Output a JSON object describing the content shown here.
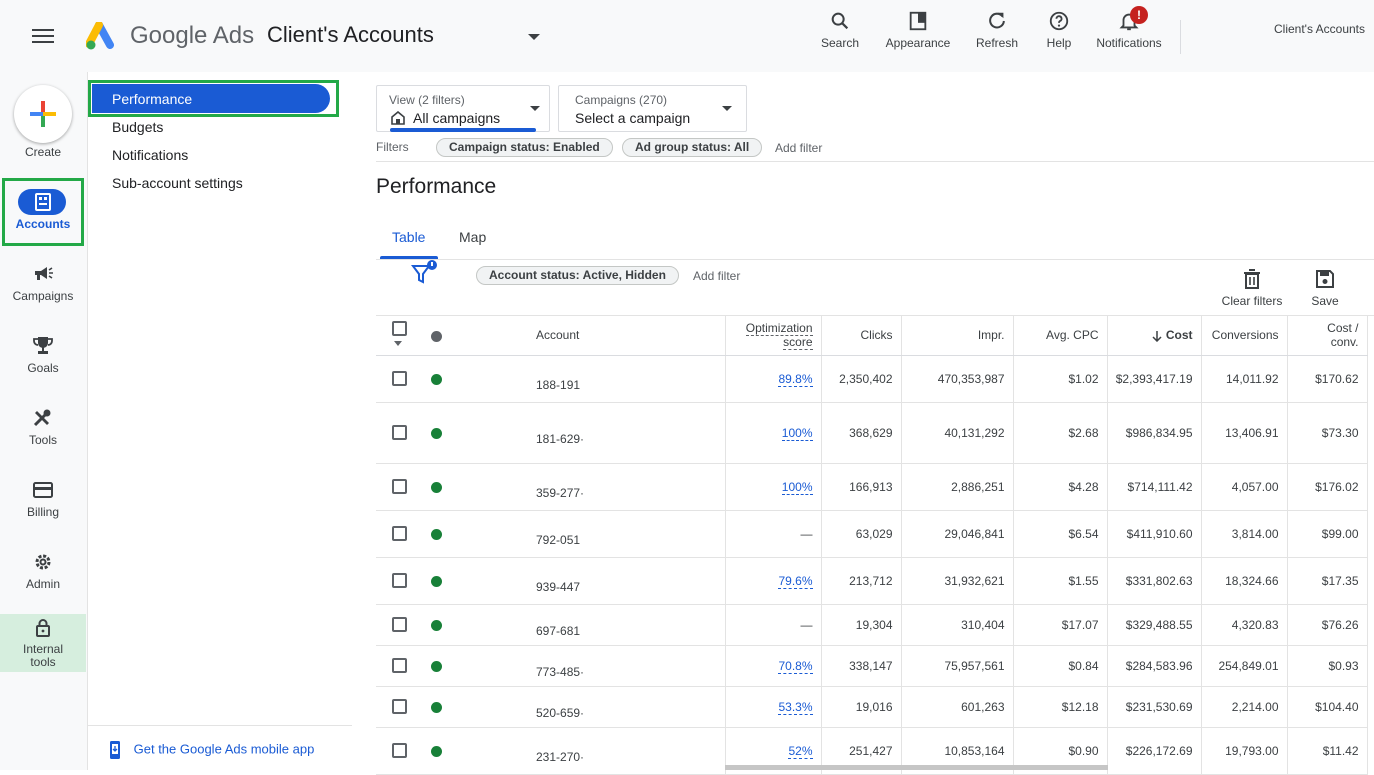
{
  "header": {
    "brand": "Google Ads",
    "account_title": "Client's Accounts",
    "tools": [
      {
        "label": "Search",
        "icon": "search-icon"
      },
      {
        "label": "Appearance",
        "icon": "appearance-icon"
      },
      {
        "label": "Refresh",
        "icon": "refresh-icon"
      },
      {
        "label": "Help",
        "icon": "help-icon"
      },
      {
        "label": "Notifications",
        "icon": "bell-icon"
      }
    ],
    "notification_badge": "!",
    "right_account": "Client's Accounts"
  },
  "rail": {
    "create": "Create",
    "items": [
      {
        "label": "Accounts",
        "icon": "accounts-icon"
      },
      {
        "label": "Campaigns",
        "icon": "megaphone-icon"
      },
      {
        "label": "Goals",
        "icon": "trophy-icon"
      },
      {
        "label": "Tools",
        "icon": "tools-icon"
      },
      {
        "label": "Billing",
        "icon": "card-icon"
      },
      {
        "label": "Admin",
        "icon": "gear-icon"
      },
      {
        "label": "Internal tools",
        "icon": "lock-icon"
      }
    ]
  },
  "subnav": {
    "items": [
      "Performance",
      "Budgets",
      "Notifications",
      "Sub-account settings"
    ],
    "mobile_link": "Get the Google Ads mobile app"
  },
  "filters": {
    "view_small": "View (2 filters)",
    "view_value": "All campaigns",
    "campaigns_small": "Campaigns (270)",
    "campaigns_value": "Select a campaign",
    "label": "Filters",
    "chips": [
      "Campaign status: Enabled",
      "Ad group status: All"
    ],
    "add_filter": "Add filter"
  },
  "main": {
    "title": "Performance",
    "tabs": [
      "Table",
      "Map"
    ],
    "table_chip": "Account status: Active, Hidden",
    "table_add_filter": "Add filter",
    "clear_filters": "Clear filters",
    "save": "Save"
  },
  "table": {
    "columns": {
      "account": "Account",
      "opt_line1": "Optimization",
      "opt_line2": "score",
      "clicks": "Clicks",
      "impr": "Impr.",
      "avg_cpc": "Avg. CPC",
      "cost": "Cost",
      "conversions": "Conversions",
      "cost_conv_line1": "Cost /",
      "cost_conv_line2": "conv."
    },
    "rows": [
      {
        "account": "188-191",
        "opt": "89.8%",
        "clicks": "2,350,402",
        "impr": "470,353,987",
        "cpc": "$1.02",
        "cost": "$2,393,417.19",
        "conv": "14,011.92",
        "cost_conv": "$170.62"
      },
      {
        "account": "181-629·",
        "opt": "100%",
        "clicks": "368,629",
        "impr": "40,131,292",
        "cpc": "$2.68",
        "cost": "$986,834.95",
        "conv": "13,406.91",
        "cost_conv": "$73.30"
      },
      {
        "account": "359-277·",
        "opt": "100%",
        "clicks": "166,913",
        "impr": "2,886,251",
        "cpc": "$4.28",
        "cost": "$714,111.42",
        "conv": "4,057.00",
        "cost_conv": "$176.02"
      },
      {
        "account": "792-051",
        "opt": "—",
        "clicks": "63,029",
        "impr": "29,046,841",
        "cpc": "$6.54",
        "cost": "$411,910.60",
        "conv": "3,814.00",
        "cost_conv": "$99.00"
      },
      {
        "account": "939-447",
        "opt": "79.6%",
        "clicks": "213,712",
        "impr": "31,932,621",
        "cpc": "$1.55",
        "cost": "$331,802.63",
        "conv": "18,324.66",
        "cost_conv": "$17.35"
      },
      {
        "account": "697-681",
        "opt": "—",
        "clicks": "19,304",
        "impr": "310,404",
        "cpc": "$17.07",
        "cost": "$329,488.55",
        "conv": "4,320.83",
        "cost_conv": "$76.26"
      },
      {
        "account": "773-485·",
        "opt": "70.8%",
        "clicks": "338,147",
        "impr": "75,957,561",
        "cpc": "$0.84",
        "cost": "$284,583.96",
        "conv": "254,849.01",
        "cost_conv": "$0.93"
      },
      {
        "account": "520-659·",
        "opt": "53.3%",
        "clicks": "19,016",
        "impr": "601,263",
        "cpc": "$12.18",
        "cost": "$231,530.69",
        "conv": "2,214.00",
        "cost_conv": "$104.40"
      },
      {
        "account": "231-270·",
        "opt": "52%",
        "clicks": "251,427",
        "impr": "10,853,164",
        "cpc": "$0.90",
        "cost": "$226,172.69",
        "conv": "19,793.00",
        "cost_conv": "$11.42"
      }
    ]
  },
  "colors": {
    "accent": "#1a5bd4",
    "highlight": "#23a947",
    "status_green": "#188038"
  }
}
